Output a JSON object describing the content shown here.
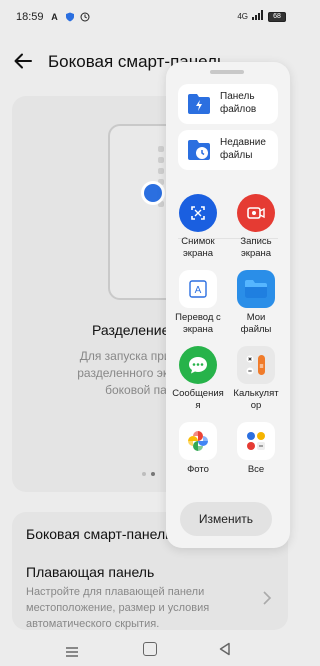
{
  "status_bar": {
    "time": "18:59",
    "signal": "4G",
    "battery": "68"
  },
  "header": {
    "title": "Боковая смарт-панель"
  },
  "feature": {
    "title": "Разделение",
    "description_lines": [
      "Для запуска прилож",
      "разделенного экрана",
      "боковой па"
    ]
  },
  "settings": {
    "item1_label": "Боковая смарт-панель",
    "item2_label": "Плавающая панель",
    "item2_desc_lines": [
      "Настройте для плавающей панели",
      "местоположение, размер и условия",
      "автоматического скрытия."
    ]
  },
  "sidebar": {
    "cards": [
      {
        "label_lines": [
          "Панель",
          "файлов"
        ],
        "icon": "file-panel-icon"
      },
      {
        "label_lines": [
          "Недавние",
          "файлы"
        ],
        "icon": "recent-files-icon"
      }
    ],
    "apps": [
      {
        "label_lines": [
          "Снимок",
          "экрана"
        ],
        "icon": "screenshot-icon",
        "color": "#1a5fe0"
      },
      {
        "label_lines": [
          "Запись",
          "экрана"
        ],
        "icon": "screen-record-icon",
        "color": "#e53b33"
      },
      {
        "label_lines": [
          "Перевод с",
          "экрана"
        ],
        "icon": "screen-translate-icon",
        "color": "#ffffff"
      },
      {
        "label_lines": [
          "Мои",
          "файлы"
        ],
        "icon": "my-files-icon",
        "color": "#2a8ee8"
      },
      {
        "label_lines": [
          "Сообщения",
          "я"
        ],
        "icon": "messages-icon",
        "color": "#27b34a"
      },
      {
        "label_lines": [
          "Калькулят",
          "ор"
        ],
        "icon": "calculator-icon",
        "color": "#e8e8e8"
      },
      {
        "label_lines": [
          "Фото",
          ""
        ],
        "icon": "photos-icon",
        "color": "#ffffff"
      },
      {
        "label_lines": [
          "Все",
          ""
        ],
        "icon": "all-apps-icon",
        "color": "#ffffff"
      }
    ],
    "edit_label": "Изменить"
  },
  "colors": {
    "accent": "#2b6fe0",
    "background": "#ececec",
    "panel": "#f3f3f3"
  }
}
